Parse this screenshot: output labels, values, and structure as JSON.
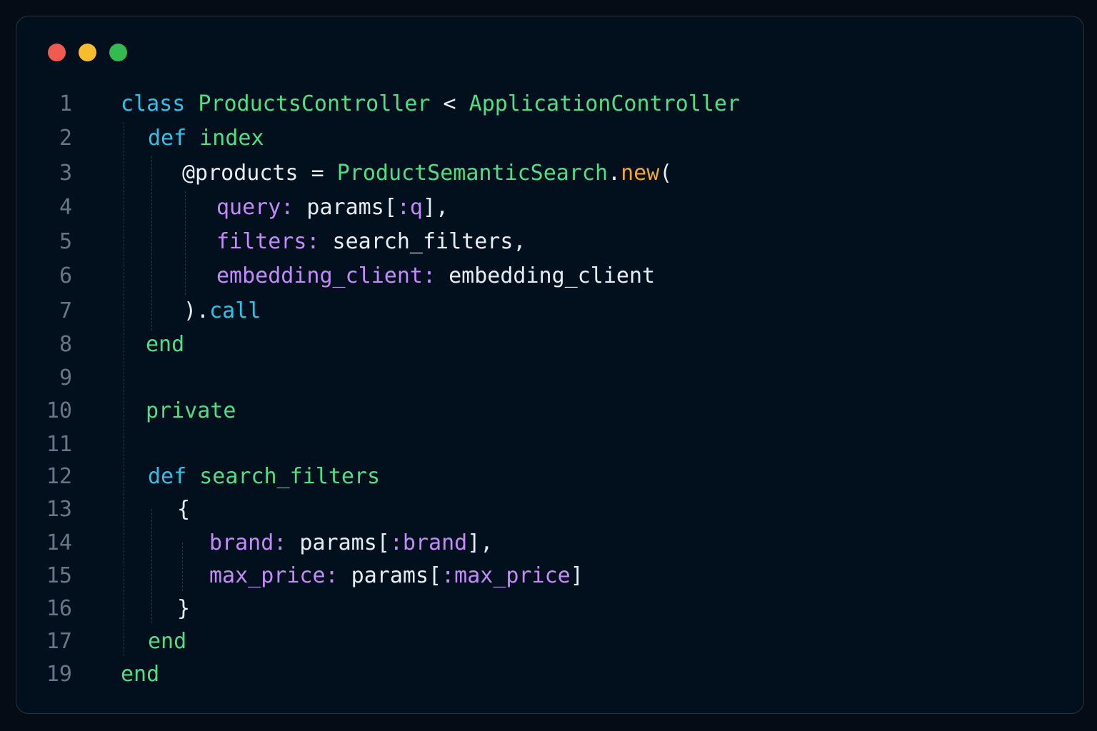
{
  "window": {
    "controls": [
      {
        "name": "close",
        "color": "#f05a4f"
      },
      {
        "name": "minimize",
        "color": "#f7bd2e"
      },
      {
        "name": "maximize",
        "color": "#35b951"
      }
    ]
  },
  "code": {
    "lines": [
      {
        "number": "1",
        "tokens": [
          {
            "t": "class",
            "c": "kw"
          },
          {
            "t": " ",
            "c": "id"
          },
          {
            "t": "ProductsController",
            "c": "cls"
          },
          {
            "t": " < ",
            "c": "op"
          },
          {
            "t": "ApplicationController",
            "c": "cls"
          }
        ]
      },
      {
        "number": "2",
        "tokens": [
          {
            "t": "def",
            "c": "kw"
          },
          {
            "t": " ",
            "c": "id"
          },
          {
            "t": "index",
            "c": "fn"
          }
        ]
      },
      {
        "number": "3",
        "tokens": [
          {
            "t": "@products",
            "c": "ivar"
          },
          {
            "t": " = ",
            "c": "op"
          },
          {
            "t": "ProductSemanticSearch",
            "c": "const"
          },
          {
            "t": ".",
            "c": "punc"
          },
          {
            "t": "new",
            "c": "new"
          },
          {
            "t": "(",
            "c": "punc"
          }
        ]
      },
      {
        "number": "4",
        "tokens": [
          {
            "t": "query:",
            "c": "sym"
          },
          {
            "t": " params[",
            "c": "id"
          },
          {
            "t": ":q",
            "c": "sym"
          },
          {
            "t": "],",
            "c": "punc"
          }
        ]
      },
      {
        "number": "5",
        "tokens": [
          {
            "t": "filters:",
            "c": "sym"
          },
          {
            "t": " search_filters,",
            "c": "id"
          }
        ]
      },
      {
        "number": "6",
        "tokens": [
          {
            "t": "embedding_client:",
            "c": "sym"
          },
          {
            "t": " embedding_client",
            "c": "id"
          }
        ]
      },
      {
        "number": "7",
        "tokens": [
          {
            "t": ").",
            "c": "punc"
          },
          {
            "t": "call",
            "c": "call"
          }
        ]
      },
      {
        "number": "8",
        "tokens": [
          {
            "t": "end",
            "c": "end"
          }
        ]
      },
      {
        "number": "9",
        "tokens": []
      },
      {
        "number": "10",
        "tokens": [
          {
            "t": "private",
            "c": "priv"
          }
        ]
      },
      {
        "number": "11",
        "tokens": []
      },
      {
        "number": "12",
        "tokens": [
          {
            "t": "def",
            "c": "kw"
          },
          {
            "t": " ",
            "c": "id"
          },
          {
            "t": "search_filters",
            "c": "fn"
          }
        ]
      },
      {
        "number": "13",
        "tokens": [
          {
            "t": "{",
            "c": "punc"
          }
        ]
      },
      {
        "number": "14",
        "tokens": [
          {
            "t": "brand:",
            "c": "sym"
          },
          {
            "t": " params[",
            "c": "id"
          },
          {
            "t": ":brand",
            "c": "sym"
          },
          {
            "t": "],",
            "c": "punc"
          }
        ]
      },
      {
        "number": "15",
        "tokens": [
          {
            "t": "max_price:",
            "c": "sym"
          },
          {
            "t": " params[",
            "c": "id"
          },
          {
            "t": ":max_price",
            "c": "sym"
          },
          {
            "t": "]",
            "c": "punc"
          }
        ]
      },
      {
        "number": "16",
        "tokens": [
          {
            "t": "}",
            "c": "punc"
          }
        ]
      },
      {
        "number": "17",
        "tokens": [
          {
            "t": "end",
            "c": "end"
          }
        ]
      },
      {
        "number": "19",
        "tokens": [
          {
            "t": "end",
            "c": "end"
          }
        ]
      }
    ]
  }
}
